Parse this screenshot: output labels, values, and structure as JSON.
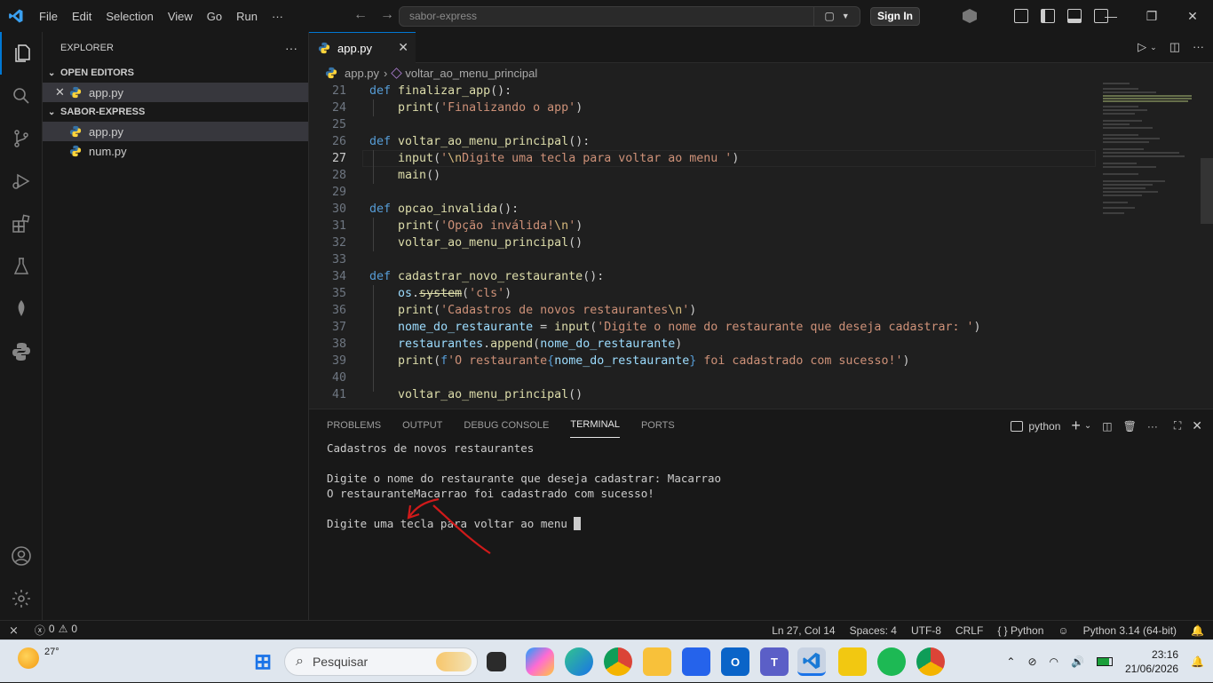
{
  "titlebar": {
    "menu": [
      "File",
      "Edit",
      "Selection",
      "View",
      "Go",
      "Run",
      "···"
    ],
    "search_placeholder": "sabor-express",
    "sign_in": "Sign In"
  },
  "sidebar": {
    "title": "EXPLORER",
    "more": "···",
    "open_editors_label": "OPEN EDITORS",
    "open_editor_file": "app.py",
    "folder_label": "SABOR-EXPRESS",
    "files": [
      "app.py",
      "num.py"
    ]
  },
  "editor": {
    "tab_label": "app.py",
    "breadcrumb_file": "app.py",
    "breadcrumb_symbol": "voltar_ao_menu_principal",
    "current_line": "27",
    "lines": [
      {
        "n": "21",
        "t": "def finalizar_app():"
      },
      {
        "n": "24",
        "t": "    print('Finalizando o app')"
      },
      {
        "n": "25",
        "t": ""
      },
      {
        "n": "26",
        "t": "def voltar_ao_menu_principal():"
      },
      {
        "n": "27",
        "t": "    input('\\nDigite uma tecla para voltar ao menu ')"
      },
      {
        "n": "28",
        "t": "    main()"
      },
      {
        "n": "29",
        "t": ""
      },
      {
        "n": "30",
        "t": "def opcao_invalida():"
      },
      {
        "n": "31",
        "t": "    print('Opção inválida!\\n')"
      },
      {
        "n": "32",
        "t": "    voltar_ao_menu_principal()"
      },
      {
        "n": "33",
        "t": ""
      },
      {
        "n": "34",
        "t": "def cadastrar_novo_restaurante():"
      },
      {
        "n": "35",
        "t": "    os.system('cls')"
      },
      {
        "n": "36",
        "t": "    print('Cadastros de novos restaurantes\\n')"
      },
      {
        "n": "37",
        "t": "    nome_do_restaurante = input('Digite o nome do restaurante que deseja cadastrar: ')"
      },
      {
        "n": "38",
        "t": "    restaurantes.append(nome_do_restaurante)"
      },
      {
        "n": "39",
        "t": "    print(f'O restaurante{nome_do_restaurante} foi cadastrado com sucesso!')"
      },
      {
        "n": "40",
        "t": ""
      },
      {
        "n": "41",
        "t": "    voltar_ao_menu_principal()"
      }
    ]
  },
  "panel": {
    "tabs": [
      "PROBLEMS",
      "OUTPUT",
      "DEBUG CONSOLE",
      "TERMINAL",
      "PORTS"
    ],
    "active_tab": "TERMINAL",
    "shell": "python",
    "terminal_lines": [
      "Cadastros de novos restaurantes",
      "",
      "Digite o nome do restaurante que deseja cadastrar: Macarrao",
      "O restauranteMacarrao foi cadastrado com sucesso!",
      "",
      "Digite uma tecla para voltar ao menu "
    ]
  },
  "status": {
    "errors": "0",
    "warnings": "0",
    "position": "Ln 27, Col 14",
    "spaces": "Spaces: 4",
    "encoding": "UTF-8",
    "eol": "CRLF",
    "language": "Python",
    "interpreter": "Python 3.14 (64-bit)"
  },
  "taskbar": {
    "temperature": "27°",
    "search_placeholder": "Pesquisar",
    "time": "23:16",
    "date": "21/06/2026"
  }
}
